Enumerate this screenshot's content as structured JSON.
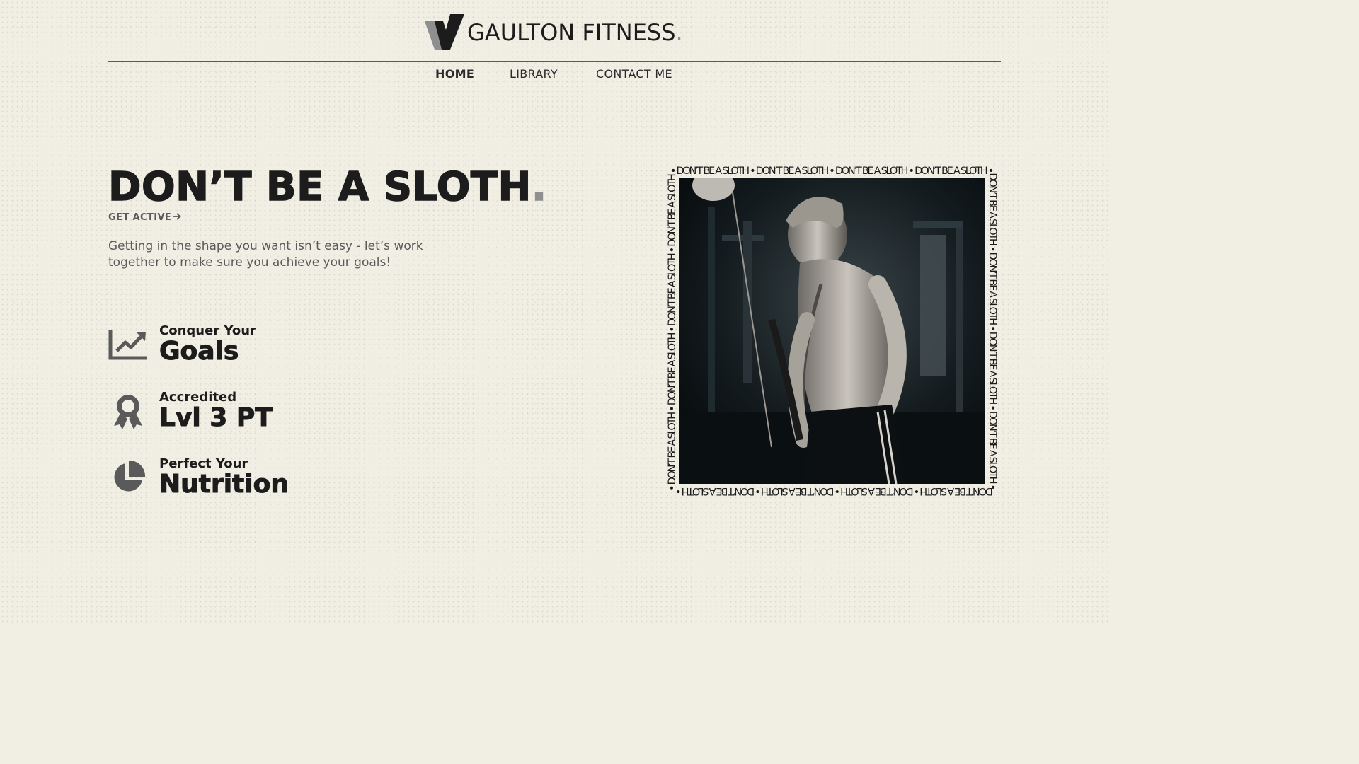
{
  "header": {
    "brand_name": "GAULTON FITNESS",
    "brand_suffix": ".",
    "logo_icon": "v-logo-icon"
  },
  "nav": {
    "items": [
      {
        "label": "HOME",
        "active": true
      },
      {
        "label": "LIBRARY",
        "active": false
      },
      {
        "label": "CONTACT ME",
        "active": false
      }
    ]
  },
  "hero": {
    "headline": "DON’T BE A SLOTH",
    "headline_suffix": ".",
    "cta_label": "GET ACTIVE",
    "cta_icon": "arrow-right-icon",
    "intro": "Getting in the shape you want isn’t easy - let’s work together to make sure you achieve your goals!"
  },
  "features": [
    {
      "icon": "trending-up-chart-icon",
      "top": "Conquer Your",
      "main": "Goals"
    },
    {
      "icon": "award-ribbon-icon",
      "top": "Accredited",
      "main": "Lvl 3 PT"
    },
    {
      "icon": "pie-chart-icon",
      "top": "Perfect Your",
      "main": "Nutrition"
    }
  ],
  "photo_frame": {
    "ring_text": "• DON’T BE A SLOTH • DON’T BE A SLOTH • DON’T BE A SLOTH • DON’T BE A SLOTH • DON’T BE A SLOTH • DON’T BE A SLOTH • DON’T BE A SLOTH • DON’T BE A SLOTH • DON’T BE A SLOTH • DON’T BE A SLOTH • DON’T BE A SLOTH • DON’T BE A SLOTH • DON’T BE A SLOTH • DON’T BE A SLOTH • DON’T BE A SLOTH • DON’T BE A SLOTH •"
  },
  "colors": {
    "background": "#f1eee4",
    "text": "#1c1c1c",
    "muted": "#5a5a5a",
    "accent_dot": "#8f8f8f"
  }
}
